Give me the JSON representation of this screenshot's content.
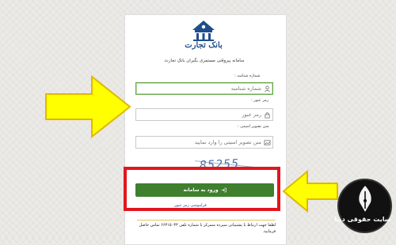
{
  "header": {
    "logo_text": "بانک تجارت",
    "subtitle": "سامانه پیروقتی مستمری بگیران بانک تجارت"
  },
  "form": {
    "username_label": "شماره شناسه :",
    "username_placeholder": "شماره شناسه",
    "password_label": "رمز عبور :",
    "password_placeholder": "رمز عبور",
    "captcha_label": "متن تصویر امنیتی :",
    "captcha_placeholder": "متن تصویر امنیتی را وارد نمایید",
    "captcha_text": "85255",
    "login_button": "ورود به سامانه",
    "forgot_link": "فراموشی رمز عبور",
    "notice": "لطفا جهت ارتباط با پشتیبانی سپرده متمرکز با شماره تلفن ۶۶۳۱۵۰۳۳ تماس حاصل فرمایید."
  },
  "overlay": {
    "brand_text": "سایت حقوقی دینا",
    "highlight_color": "#e2161d",
    "arrow_color": "#ffff00",
    "button_color": "#3f7f2e"
  }
}
